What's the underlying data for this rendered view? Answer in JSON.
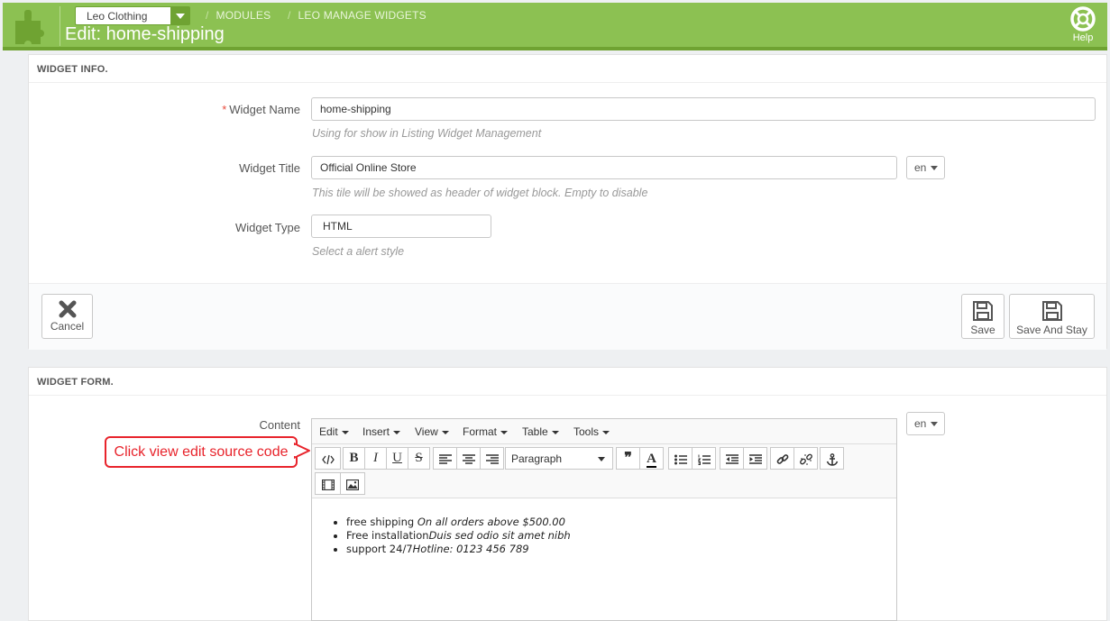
{
  "header": {
    "shop": "Leo Clothing",
    "breadcrumb": [
      "MODULES",
      "LEO MANAGE WIDGETS"
    ],
    "title": "Edit: home-shipping",
    "help": "Help"
  },
  "widget_info": {
    "heading": "WIDGET INFO.",
    "name_label": "Widget Name",
    "required_mark": "*",
    "name_value": "home-shipping",
    "name_hint": "Using for show in Listing Widget Management",
    "title_label": "Widget Title",
    "title_value": "Official Online Store",
    "title_lang": "en",
    "title_hint": "This tile will be showed as header of widget block. Empty to disable",
    "type_label": "Widget Type",
    "type_value": "HTML",
    "type_hint": "Select a alert style",
    "cancel": "Cancel",
    "save": "Save",
    "save_stay": "Save And Stay"
  },
  "widget_form": {
    "heading": "WIDGET FORM.",
    "content_label": "Content",
    "lang": "en",
    "menu": [
      "Edit",
      "Insert",
      "View",
      "Format",
      "Table",
      "Tools"
    ],
    "format_select": "Paragraph",
    "items": [
      {
        "text": "free shipping ",
        "em": "On all orders above $500.00"
      },
      {
        "text": "Free installation",
        "em": "Duis sed odio sit amet nibh"
      },
      {
        "text": "support 24/7",
        "em": "Hotline: 0123 456 789"
      }
    ]
  },
  "callout": "Click view edit source code",
  "colors": {
    "header": "#8cc152",
    "accent_dark": "#6fa332",
    "callout": "#e8242c"
  }
}
